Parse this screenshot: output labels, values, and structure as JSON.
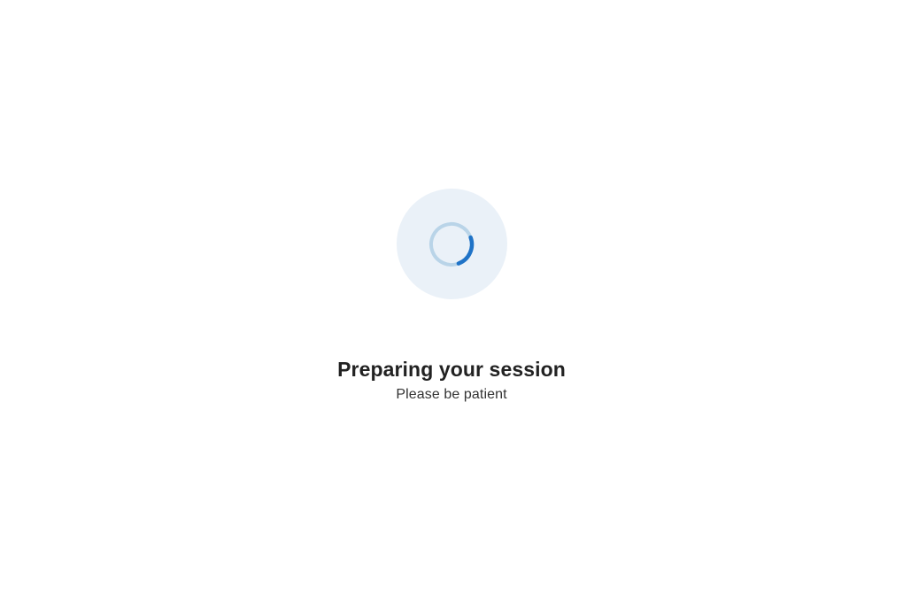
{
  "loading": {
    "title": "Preparing your session",
    "subtitle": "Please be patient"
  },
  "colors": {
    "spinner_bg": "#eaf1f8",
    "spinner_track": "#b9d4e8",
    "spinner_arc": "#1f73c7"
  }
}
